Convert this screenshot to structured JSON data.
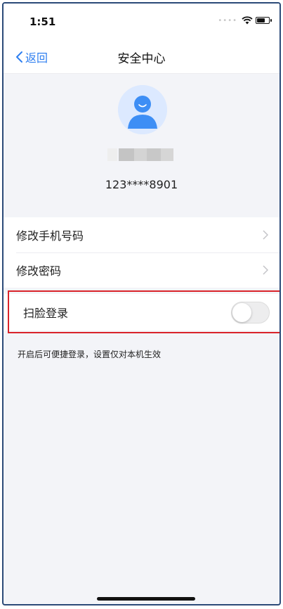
{
  "status_bar": {
    "time": "1:51",
    "icons": [
      "signal-dots-icon",
      "wifi-icon",
      "battery-icon"
    ]
  },
  "nav": {
    "back_label": "返回",
    "back_icon": "chevron-left-icon",
    "title": "安全中心"
  },
  "profile": {
    "avatar_icon": "user-avatar-icon",
    "phone_number": "123****8901"
  },
  "settings": {
    "items": [
      {
        "label": "修改手机号码",
        "icon": "chevron-right-icon"
      },
      {
        "label": "修改密码",
        "icon": "chevron-right-icon"
      }
    ],
    "face_login": {
      "label": "扫脸登录",
      "enabled": false
    },
    "hint": "开启后可便捷登录，设置仅对本机生效"
  },
  "colors": {
    "accent": "#2f7ff0",
    "background": "#f3f4f8",
    "highlight": "#d9232a",
    "avatar_bg": "#dce9ff"
  }
}
